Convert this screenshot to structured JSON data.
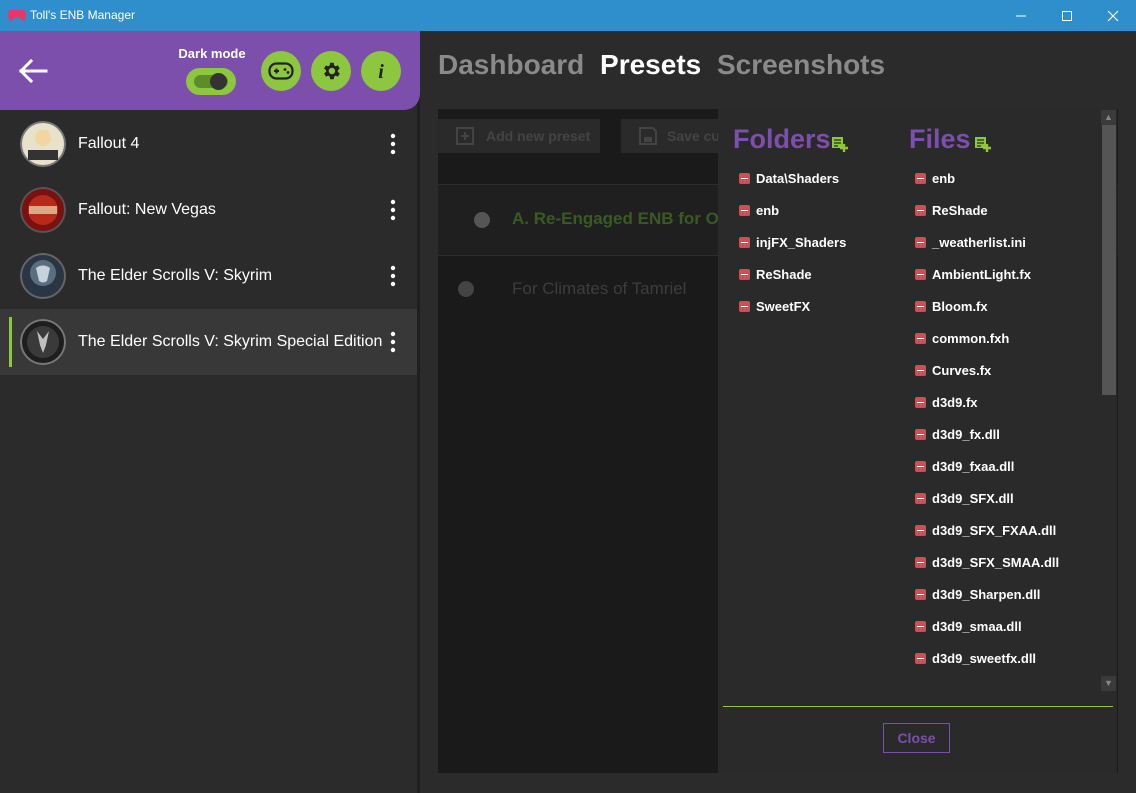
{
  "window": {
    "title": "Toll's ENB Manager",
    "accent": "#2e8fcc"
  },
  "sidebar": {
    "dark_mode_label": "Dark mode",
    "dark_mode_on": true,
    "header_color": "#7c4fad",
    "button_color": "#8dc63f",
    "buttons": [
      "gamepad-icon",
      "gear-icon",
      "info-icon"
    ],
    "games": [
      {
        "name": "Fallout 4",
        "icon": "fallout4-icon",
        "selected": false
      },
      {
        "name": "Fallout: New Vegas",
        "icon": "fallout-new-vegas-icon",
        "selected": false
      },
      {
        "name": "The Elder Scrolls V: Skyrim",
        "icon": "skyrim-icon",
        "selected": false
      },
      {
        "name": "The Elder Scrolls V: Skyrim Special Edition",
        "icon": "skyrim-se-icon",
        "selected": true
      }
    ]
  },
  "main": {
    "tabs": [
      {
        "label": "Dashboard",
        "active": false
      },
      {
        "label": "Presets",
        "active": true
      },
      {
        "label": "Screenshots",
        "active": false
      }
    ],
    "toolbar": {
      "add_label": "Add new preset",
      "save_label": "Save cu"
    },
    "presets": [
      {
        "title": "A. Re-Engaged ENB for Ol"
      },
      {
        "title": "For Climates of Tamriel"
      }
    ]
  },
  "dialog": {
    "folders_title": "Folders",
    "files_title": "Files",
    "folders": [
      "Data\\Shaders",
      "enb",
      "injFX_Shaders",
      "ReShade",
      "SweetFX"
    ],
    "files": [
      "enb",
      "ReShade",
      "_weatherlist.ini",
      "AmbientLight.fx",
      "Bloom.fx",
      "common.fxh",
      "Curves.fx",
      "d3d9.fx",
      "d3d9_fx.dll",
      "d3d9_fxaa.dll",
      "d3d9_SFX.dll",
      "d3d9_SFX_FXAA.dll",
      "d3d9_SFX_SMAA.dll",
      "d3d9_Sharpen.dll",
      "d3d9_smaa.dll",
      "d3d9_sweetfx.dll"
    ],
    "close_label": "Close"
  }
}
